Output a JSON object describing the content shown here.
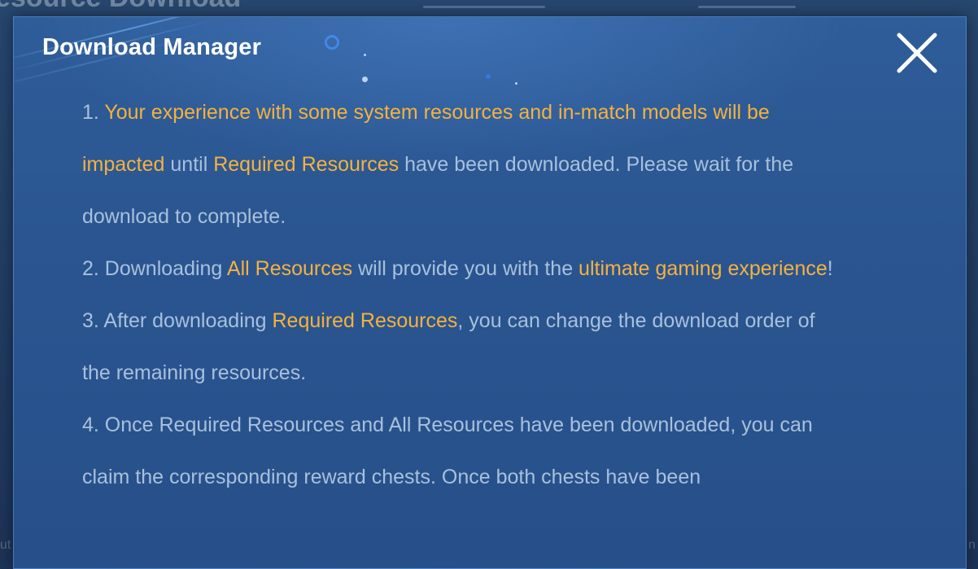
{
  "background": {
    "title": "esource Download",
    "side_left": "ut",
    "side_right": "n"
  },
  "dialog": {
    "title": "Download Manager",
    "close_icon": "close-x-icon",
    "paragraphs": [
      {
        "segments": [
          {
            "text": "1. ",
            "hl": false
          },
          {
            "text": "Your experience with some system resources and in-match models will be impacted",
            "hl": true
          },
          {
            "text": " until ",
            "hl": false
          },
          {
            "text": "Required Resources",
            "hl": true
          },
          {
            "text": " have been downloaded. Please wait for the download to complete.",
            "hl": false
          }
        ]
      },
      {
        "segments": [
          {
            "text": "2. Downloading ",
            "hl": false
          },
          {
            "text": "All Resources",
            "hl": true
          },
          {
            "text": " will provide you with the ",
            "hl": false
          },
          {
            "text": "ultimate gaming experience",
            "hl": true
          },
          {
            "text": "!",
            "hl": false
          }
        ]
      },
      {
        "segments": [
          {
            "text": "3. After downloading ",
            "hl": false
          },
          {
            "text": "Required Resources",
            "hl": true
          },
          {
            "text": ", you can change the download order of the remaining resources.",
            "hl": false
          }
        ]
      },
      {
        "segments": [
          {
            "text": "4. Once Required Resources and All Resources have been downloaded, you can claim the corresponding reward chests. Once both chests have been",
            "hl": false
          }
        ]
      }
    ]
  },
  "colors": {
    "highlight": "#f4b23f",
    "body_text": "#a9c0dc",
    "title_text": "#ffffff",
    "panel": "#2a5590"
  }
}
